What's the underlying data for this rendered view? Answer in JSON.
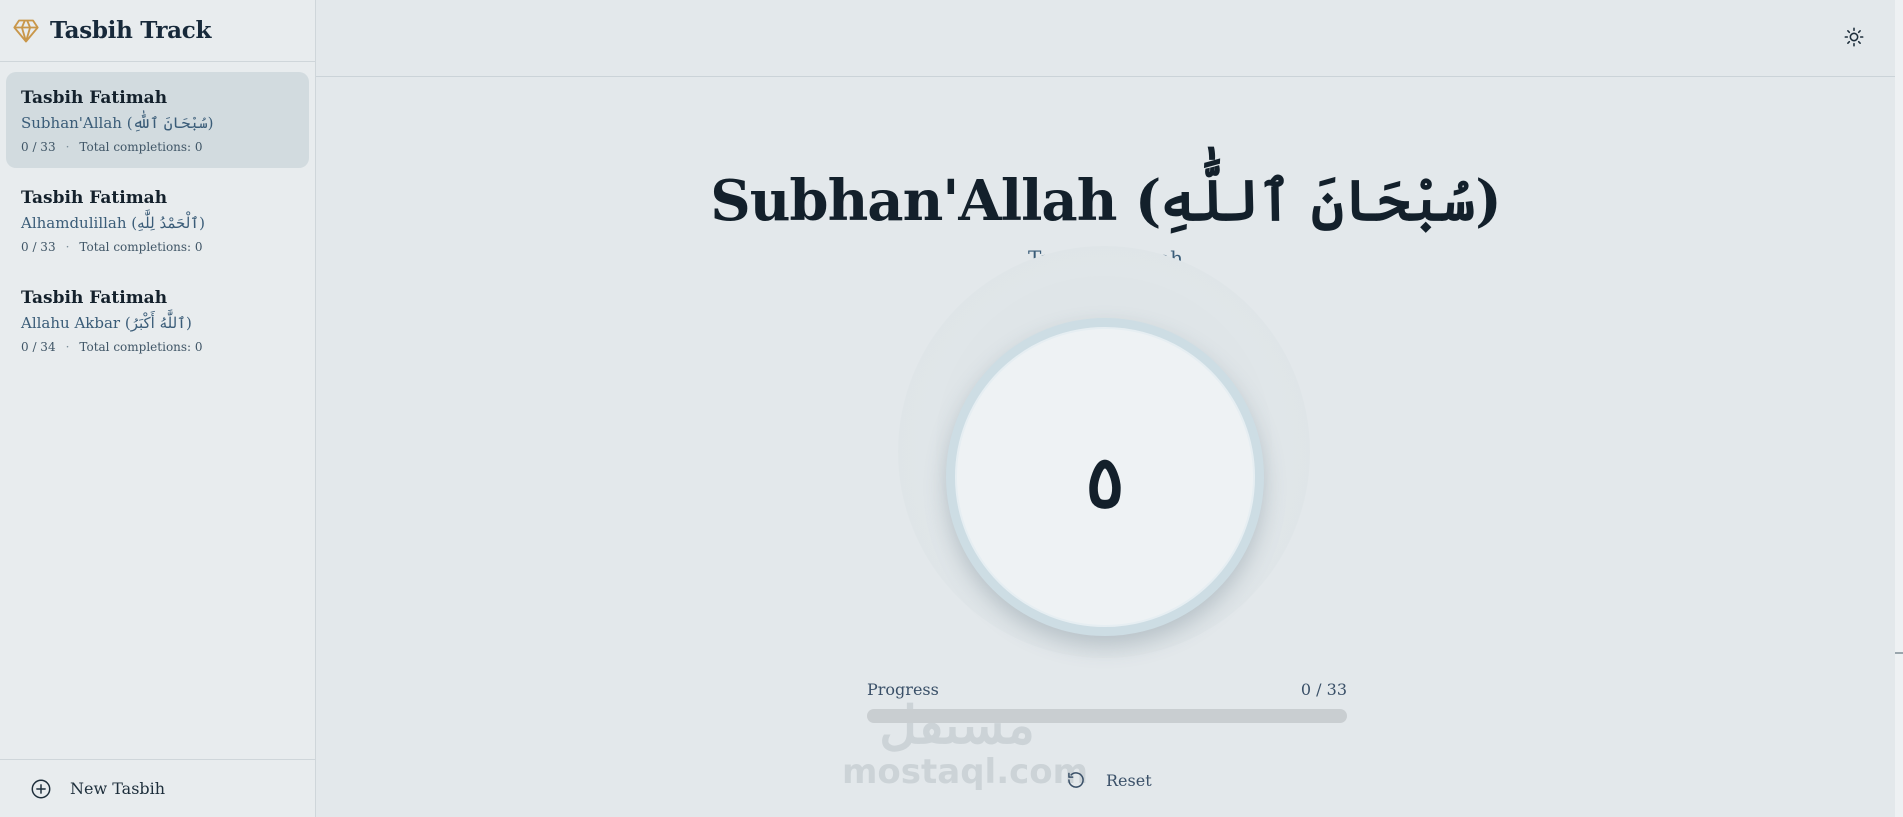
{
  "app": {
    "title": "Tasbih Track"
  },
  "sidebar": {
    "items": [
      {
        "name": "Tasbih Fatimah",
        "dhikr": "Subhan'Allah (سُبْحَانَ ٱللَّٰهِ)",
        "count": "0 / 33",
        "completions": "Total completions: 0",
        "active": true
      },
      {
        "name": "Tasbih Fatimah",
        "dhikr": "Alhamdulillah (ٱلْحَمْدُ لِلَّٰهِ)",
        "count": "0 / 33",
        "completions": "Total completions: 0",
        "active": false
      },
      {
        "name": "Tasbih Fatimah",
        "dhikr": "Allahu Akbar (ٱللَّٰهُ أَكْبَرُ)",
        "count": "0 / 34",
        "completions": "Total completions: 0",
        "active": false
      }
    ],
    "dot": "·",
    "new_label": "New Tasbih"
  },
  "main": {
    "title": "Subhan'Allah (سُبْحَانَ ٱللَّٰهِ)",
    "subtitle": "Tasbih Fatimah",
    "count": "٥",
    "progress_label": "Progress",
    "progress_value": "0 / 33",
    "progress_fraction": 0,
    "reset_label": "Reset"
  },
  "watermark": {
    "arabic": "مستقل",
    "latin": "mostaql.com"
  },
  "colors": {
    "accent": "#3a5c78",
    "gem": "#c9974a",
    "text": "#13202b",
    "background": "#e3e8eb"
  },
  "icons": {
    "logo": "gem-icon",
    "theme": "sun-icon",
    "new": "plus-circle-icon",
    "reset": "rotate-ccw-icon"
  }
}
